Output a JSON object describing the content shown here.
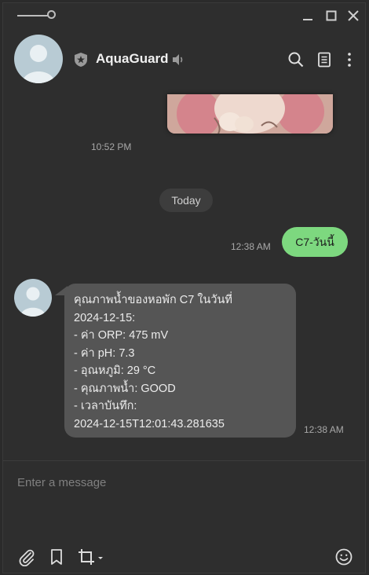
{
  "chat": {
    "title": "AquaGuard",
    "image_time": "10:52 PM",
    "date_divider": "Today",
    "outgoing": {
      "text": "C7-วันนี้",
      "time": "12:38 AM"
    },
    "incoming": {
      "text": "คุณภาพน้ำของหอพัก C7 ในวันที่\n2024-12-15:\n- ค่า ORP: 475 mV\n- ค่า pH: 7.3\n- อุณหภูมิ: 29 °C\n- คุณภาพน้ำ: GOOD\n- เวลาบันทึก:\n2024-12-15T12:01:43.281635",
      "time": "12:38 AM"
    }
  },
  "composer": {
    "placeholder": "Enter a message"
  },
  "icons": {
    "header": [
      "shield-star-icon",
      "speaker-icon",
      "search-icon",
      "notes-icon",
      "more-vertical-icon"
    ],
    "window": [
      "minimize-icon",
      "maximize-icon",
      "close-icon"
    ],
    "toolbar": [
      "paperclip-icon",
      "bookmark-icon",
      "crop-icon",
      "emoji-icon"
    ]
  },
  "colors": {
    "outgoing_bubble": "#7dd87f",
    "incoming_bubble": "#555555",
    "background": "#2e2e2e"
  }
}
